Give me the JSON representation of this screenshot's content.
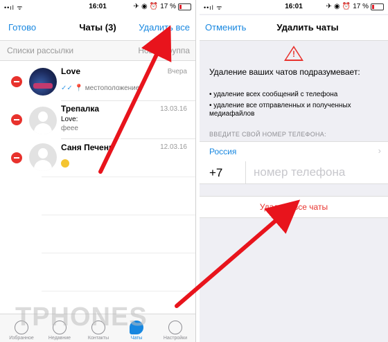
{
  "status_bar": {
    "signal": "••ıl ᯤ",
    "time": "16:01",
    "battery_percent": "17 %",
    "battery_level": 0.17,
    "icons": [
      "airplane-icon",
      "lock-rotation-icon",
      "alarm-icon"
    ]
  },
  "left": {
    "nav": {
      "left": "Готово",
      "title": "Чаты (3)",
      "right": "Удалить все"
    },
    "broadcast": {
      "left": "Списки рассылки",
      "right": "Новая группа"
    },
    "chats": [
      {
        "name": "Love",
        "date": "Вчера",
        "preview_ticks": "✓✓",
        "preview": "местоположение",
        "avatar": "photo"
      },
      {
        "name": "Трепалка",
        "date": "13.03.16",
        "preview": "Love:",
        "preview2": "феее",
        "avatar": "placeholder"
      },
      {
        "name": "Саня Печень",
        "date": "12.03.16",
        "preview": "",
        "avatar": "placeholder",
        "emoji": "smile"
      }
    ],
    "tabs": [
      {
        "label": "Избранное",
        "icon": "star-icon"
      },
      {
        "label": "Недавние",
        "icon": "clock-icon"
      },
      {
        "label": "Контакты",
        "icon": "contacts-icon"
      },
      {
        "label": "Чаты",
        "icon": "chats-icon",
        "active": true
      },
      {
        "label": "Настройки",
        "icon": "settings-icon"
      }
    ],
    "watermark": "TPHONES"
  },
  "right": {
    "nav": {
      "left": "Отменить",
      "title": "Удалить чаты"
    },
    "heading": "Удаление ваших чатов подразумевает:",
    "bullets": [
      "• удаление всех сообщений с телефона",
      "• удаление все отправленных и полученных медиафайлов"
    ],
    "section_label": "ВВЕДИТЕ СВОЙ НОМЕР ТЕЛЕФОНА:",
    "country": "Россия",
    "phone_code": "+7",
    "phone_placeholder": "номер телефона",
    "delete_all": "Удалить все чаты"
  },
  "colors": {
    "accent": "#1787e0",
    "danger": "#e8322d",
    "annotation_arrow": "#e8141c"
  }
}
